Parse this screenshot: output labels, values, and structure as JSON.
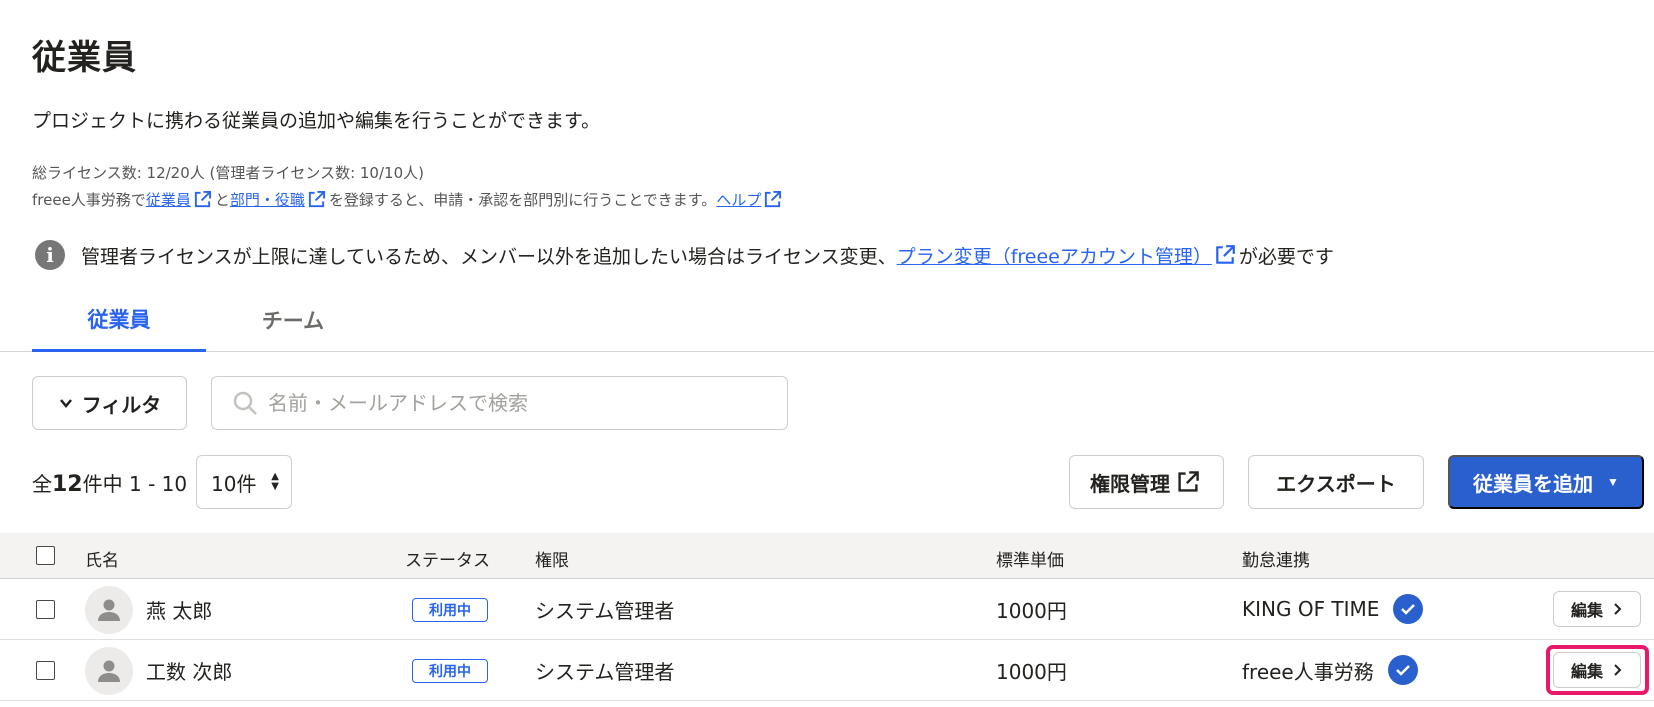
{
  "page": {
    "title": "従業員",
    "description": "プロジェクトに携わる従業員の追加や編集を行うことができます。",
    "license_info": "総ライセンス数: 12/20人 (管理者ライセンス数: 10/10人)",
    "hr_line": {
      "prefix": "freee人事労務で",
      "link_employees": "従業員",
      "mid": "と",
      "link_departments": "部門・役職",
      "suffix": "を登録すると、申請・承認を部門別に行うことできます。",
      "link_help": "ヘルプ"
    },
    "notice": {
      "text": "管理者ライセンスが上限に達しているため、メンバー以外を追加したい場合はライセンス変更、",
      "link": "プラン変更（freeeアカウント管理）",
      "suffix": "が必要です"
    }
  },
  "tabs": [
    {
      "label": "従業員",
      "active": true
    },
    {
      "label": "チーム",
      "active": false
    }
  ],
  "toolbar": {
    "filter_label": "フィルタ",
    "search_placeholder": "名前・メールアドレスで検索",
    "count_prefix": "全",
    "count_total": "12",
    "count_suffix": "件中 1 - 10",
    "per_page": "10件",
    "permission_button": "権限管理",
    "export_button": "エクスポート",
    "add_button": "従業員を追加"
  },
  "table": {
    "headers": {
      "name": "氏名",
      "status": "ステータス",
      "role": "権限",
      "unit_price": "標準単価",
      "attendance": "勤怠連携"
    },
    "rows": [
      {
        "name": "燕 太郎",
        "status": "利用中",
        "role": "システム管理者",
        "unit_price": "1000円",
        "attendance": "KING OF TIME",
        "edit": "編集",
        "highlighted": false
      },
      {
        "name": "工数 次郎",
        "status": "利用中",
        "role": "システム管理者",
        "unit_price": "1000円",
        "attendance": "freee人事労務",
        "edit": "編集",
        "highlighted": true
      }
    ]
  },
  "colors": {
    "accent": "#2864f0",
    "primary_button": "#2a5fce",
    "highlight": "#e8196b"
  }
}
